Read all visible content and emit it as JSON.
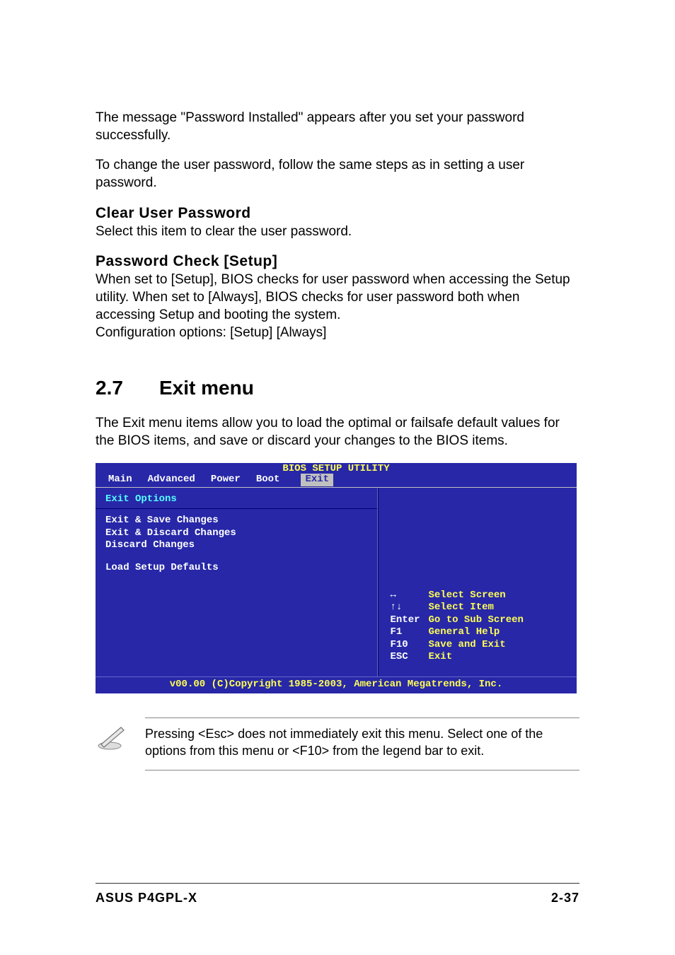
{
  "intro1": "The message \"Password Installed\" appears after you set your password successfully.",
  "intro2": "To change the user password, follow the same steps as in setting a user password.",
  "clear_head": "Clear User Password",
  "clear_text": "Select this item to clear the user password.",
  "pwcheck_head": "Password Check [Setup]",
  "pwcheck_text": "When set to [Setup], BIOS checks for user password when accessing the Setup utility. When set to [Always], BIOS checks for user password both when accessing Setup and booting the system.",
  "pwcheck_conf": "Configuration options: [Setup] [Always]",
  "section_num": "2.7",
  "section_title": "Exit menu",
  "exit_intro": "The Exit menu items allow you to load the optimal or failsafe default values for the BIOS items, and save or discard your changes to the BIOS items.",
  "bios": {
    "title": "BIOS SETUP UTILITY",
    "tabs": {
      "main": "Main",
      "advanced": "Advanced",
      "power": "Power",
      "boot": "Boot",
      "exit": "Exit"
    },
    "menu_title": "Exit Options",
    "items": {
      "i1": "Exit & Save Changes",
      "i2": "Exit & Discard Changes",
      "i3": "Discard Changes",
      "i4": "Load Setup Defaults"
    },
    "help": {
      "r1k": "↔",
      "r1d": "Select Screen",
      "r2k": "↑↓",
      "r2d": "Select Item",
      "r3k": "Enter",
      "r3d": "Go to Sub Screen",
      "r4k": "F1",
      "r4d": "General Help",
      "r5k": "F10",
      "r5d": "Save and Exit",
      "r6k": "ESC",
      "r6d": "Exit"
    },
    "footer": "v00.00 (C)Copyright 1985-2003, American Megatrends, Inc."
  },
  "note": "Pressing <Esc> does not immediately exit this menu. Select one of the options from this menu or <F10> from the legend bar to exit.",
  "page_footer_left": "ASUS P4GPL-X",
  "page_footer_right": "2-37"
}
